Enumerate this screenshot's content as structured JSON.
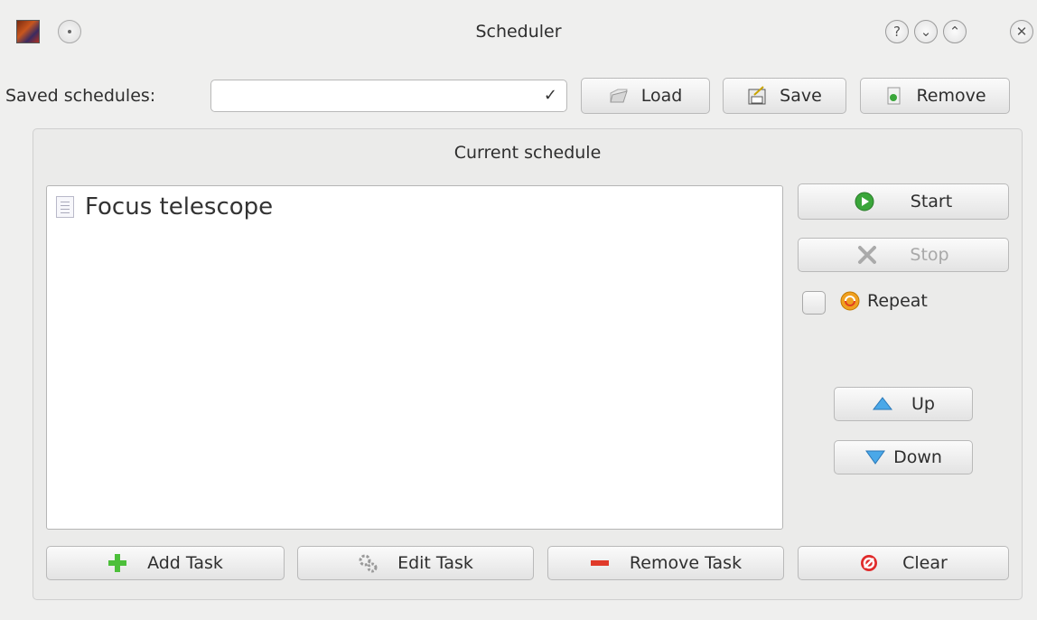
{
  "window": {
    "title": "Scheduler",
    "controls": [
      {
        "name": "help-button",
        "icon": "question-icon",
        "glyph": "?"
      },
      {
        "name": "minimize-button",
        "icon": "chevron-down-icon",
        "glyph": "⌄"
      },
      {
        "name": "maximize-button",
        "icon": "chevron-up-icon",
        "glyph": "⌃"
      },
      {
        "name": "close-button",
        "icon": "close-icon",
        "glyph": "✕"
      }
    ]
  },
  "saved": {
    "label": "Saved schedules:",
    "value": "",
    "load_label": "Load",
    "save_label": "Save",
    "remove_label": "Remove"
  },
  "current": {
    "title": "Current schedule",
    "tasks": [
      {
        "label": "Focus telescope",
        "icon": "document-icon"
      }
    ],
    "start_label": "Start",
    "stop_label": "Stop",
    "repeat_label": "Repeat",
    "repeat_checked": false,
    "up_label": "Up",
    "down_label": "Down",
    "add_label": "Add Task",
    "edit_label": "Edit Task",
    "remove_task_label": "Remove Task",
    "clear_label": "Clear"
  },
  "colors": {
    "start": "#3aa63a",
    "repeat": "#f0a020",
    "arrows": "#4aa8e8",
    "add": "#4cbf3a",
    "remove_task": "#e03a2a",
    "clear": "#e02a2a"
  }
}
